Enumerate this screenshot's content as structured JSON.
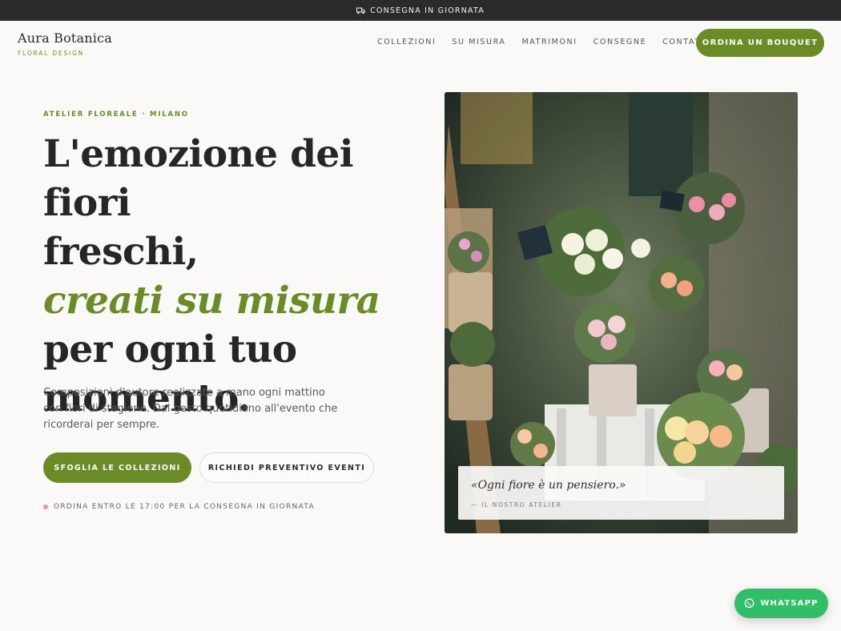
{
  "topbar": {
    "text": "CONSEGNA IN GIORNATA",
    "icon": "truck-icon"
  },
  "brand": {
    "name": "Aura Botanica",
    "tagline": "FLORAL DESIGN"
  },
  "nav": {
    "items": [
      "COLLEZIONI",
      "SU MISURA",
      "MATRIMONI",
      "CONSEGNE",
      "CONTATTI"
    ],
    "cta": "ORDINA UN BOUQUET"
  },
  "hero": {
    "eyebrow": "ATELIER FLOREALE · MILANO",
    "line1": "L'emozione dei fiori",
    "line2": "freschi,",
    "accent": "creati su misura",
    "line3": "per ogni tuo",
    "line4": "momento.",
    "lead": "Composizioni d'autore realizzate a mano ogni mattino con fiori di stagione. Dal gesto quotidiano all'evento che ricorderai per sempre.",
    "primary_button": "SFOGLIA LE COLLEZIONI",
    "secondary_button": "RICHIEDI PREVENTIVO EVENTI",
    "note": "ORDINA ENTRO LE 17:00 PER LA CONSEGNA IN GIORNATA"
  },
  "quote": {
    "text": "«Ogni fiore è un pensiero.»",
    "author": "— IL NOSTRO ATELIER"
  },
  "whatsapp": {
    "label": "WHATSAPP",
    "icon": "whatsapp-icon"
  },
  "colors": {
    "accent": "#6a8b26",
    "dark": "#2b2b2b",
    "whatsapp": "#2fbf66",
    "note_dot": "#e79a8b"
  }
}
